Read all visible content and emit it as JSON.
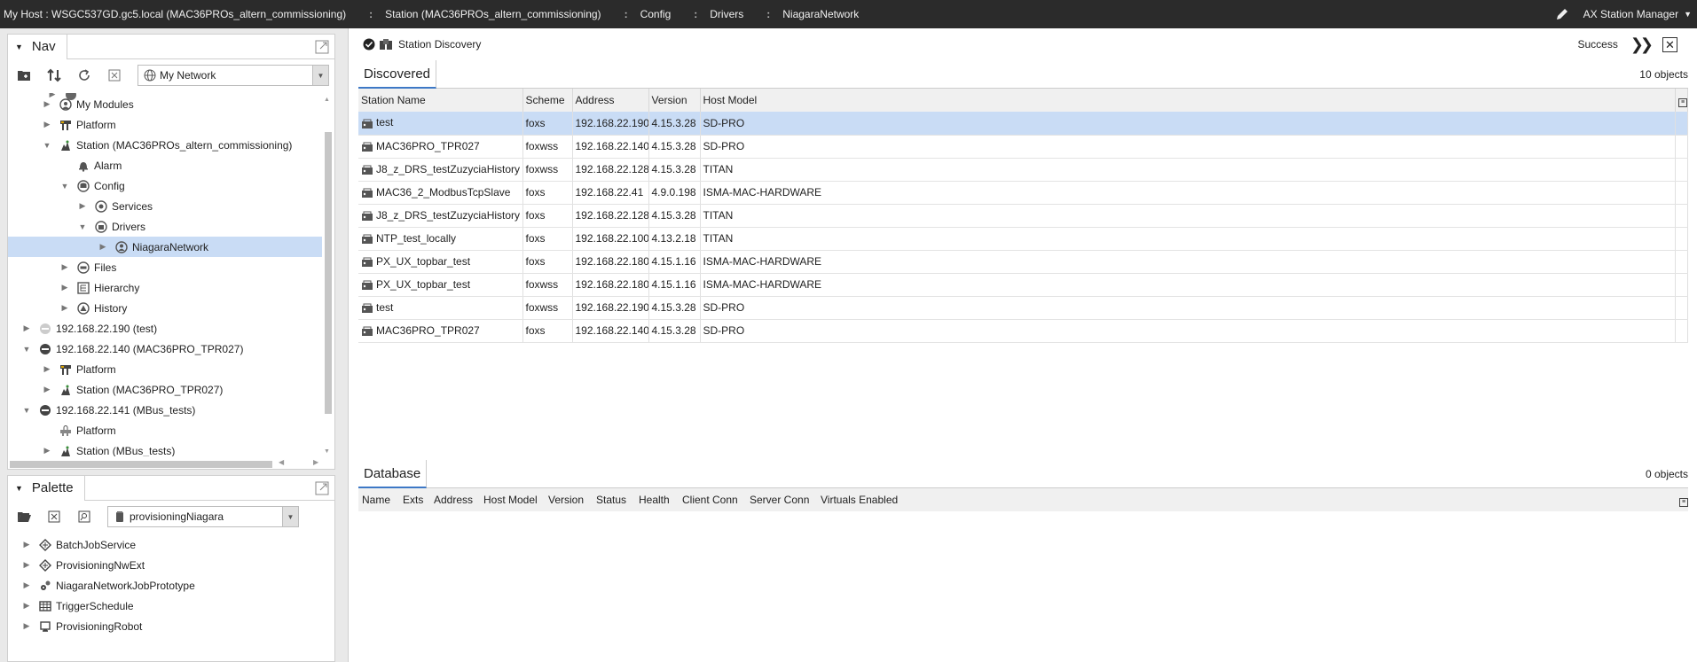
{
  "topbar": {
    "host": "My Host : WSGC537GD.gc5.local (MAC36PROs_altern_commissioning)",
    "crumbs": [
      "Station (MAC36PROs_altern_commissioning)",
      "Config",
      "Drivers",
      "NiagaraNetwork"
    ],
    "manager_label": "AX Station Manager"
  },
  "nav": {
    "title": "Nav",
    "network_select": "My Network",
    "tree": [
      {
        "label": "My Modules",
        "icon": "modules-icon"
      },
      {
        "label": "Platform",
        "icon": "platform-icon"
      },
      {
        "label": "Station (MAC36PROs_altern_commissioning)",
        "icon": "station-icon"
      },
      {
        "label": "Alarm",
        "icon": "bell-icon"
      },
      {
        "label": "Config",
        "icon": "database-icon"
      },
      {
        "label": "Services",
        "icon": "services-icon"
      },
      {
        "label": "Drivers",
        "icon": "drivers-icon"
      },
      {
        "label": "NiagaraNetwork",
        "icon": "network-icon"
      },
      {
        "label": "Files",
        "icon": "files-icon"
      },
      {
        "label": "Hierarchy",
        "icon": "hierarchy-icon"
      },
      {
        "label": "History",
        "icon": "history-icon"
      },
      {
        "label": "192.168.22.190 (test)",
        "icon": "host-disabled-icon"
      },
      {
        "label": "192.168.22.140 (MAC36PRO_TPR027)",
        "icon": "host-icon"
      },
      {
        "label": "Platform",
        "icon": "platform-icon"
      },
      {
        "label": "Station (MAC36PRO_TPR027)",
        "icon": "station-icon"
      },
      {
        "label": "192.168.22.141 (MBus_tests)",
        "icon": "host-icon"
      },
      {
        "label": "Platform",
        "icon": "platform-locked-icon"
      },
      {
        "label": "Station (MBus_tests)",
        "icon": "station-icon"
      }
    ]
  },
  "palette": {
    "title": "Palette",
    "module_select": "provisioningNiagara",
    "items": [
      "BatchJobService",
      "ProvisioningNwExt",
      "NiagaraNetworkJobPrototype",
      "TriggerSchedule",
      "ProvisioningRobot"
    ]
  },
  "main": {
    "view_title": "Station Discovery",
    "status": "Success",
    "discovered": {
      "title": "Discovered",
      "count": "10 objects",
      "columns": [
        "Station Name",
        "Scheme",
        "Address",
        "Version",
        "Host Model"
      ],
      "rows": [
        [
          "test",
          "foxs",
          "192.168.22.190",
          "4.15.3.28",
          "SD-PRO"
        ],
        [
          "MAC36PRO_TPR027",
          "foxwss",
          "192.168.22.140",
          "4.15.3.28",
          "SD-PRO"
        ],
        [
          "J8_z_DRS_testZuzyciaHistory",
          "foxwss",
          "192.168.22.128",
          "4.15.3.28",
          "TITAN"
        ],
        [
          "MAC36_2_ModbusTcpSlave",
          "foxs",
          "192.168.22.41",
          "4.9.0.198",
          "ISMA-MAC-HARDWARE"
        ],
        [
          "J8_z_DRS_testZuzyciaHistory",
          "foxs",
          "192.168.22.128",
          "4.15.3.28",
          "TITAN"
        ],
        [
          "NTP_test_locally",
          "foxs",
          "192.168.22.100",
          "4.13.2.18",
          "TITAN"
        ],
        [
          "PX_UX_topbar_test",
          "foxs",
          "192.168.22.180",
          "4.15.1.16",
          "ISMA-MAC-HARDWARE"
        ],
        [
          "PX_UX_topbar_test",
          "foxwss",
          "192.168.22.180",
          "4.15.1.16",
          "ISMA-MAC-HARDWARE"
        ],
        [
          "test",
          "foxwss",
          "192.168.22.190",
          "4.15.3.28",
          "SD-PRO"
        ],
        [
          "MAC36PRO_TPR027",
          "foxs",
          "192.168.22.140",
          "4.15.3.28",
          "SD-PRO"
        ]
      ]
    },
    "database": {
      "title": "Database",
      "count": "0 objects",
      "columns": [
        "Name",
        "Exts",
        "Address",
        "Host Model",
        "Version",
        "Status",
        "Health",
        "Client Conn",
        "Server Conn",
        "Virtuals Enabled"
      ]
    }
  },
  "colors": {
    "topbar_bg": "#2b2b2b",
    "selection": "#c9dcf5",
    "accent": "#3d78c6"
  }
}
